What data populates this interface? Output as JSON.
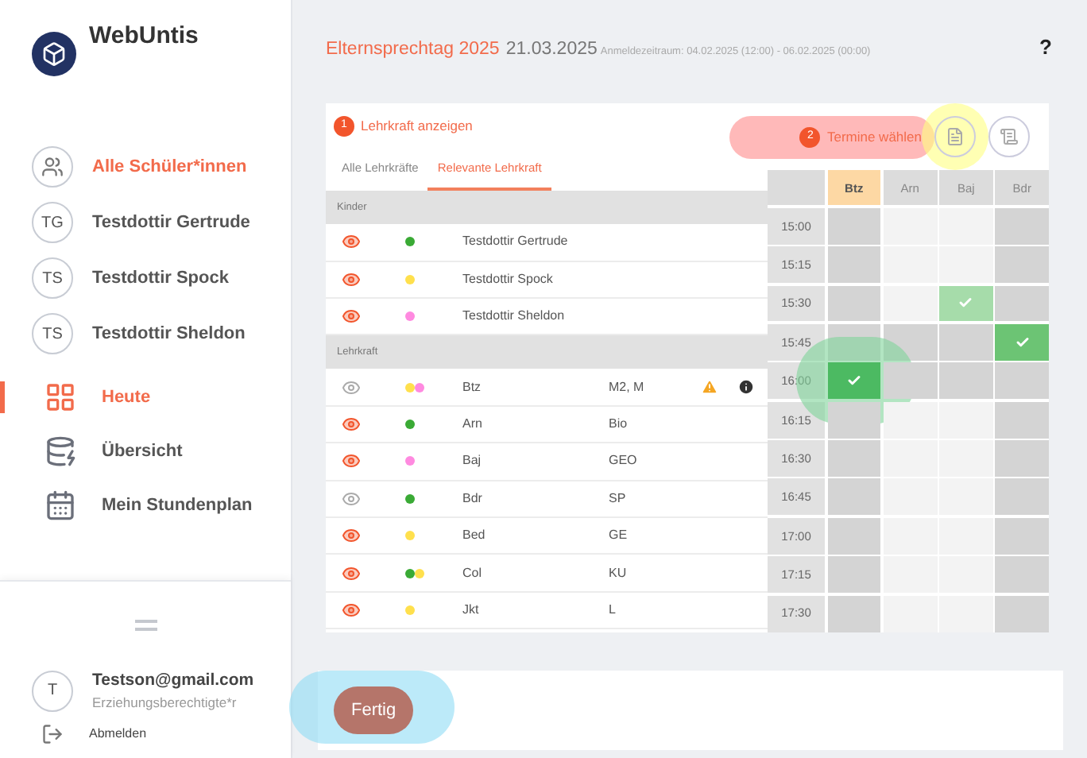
{
  "sidebar": {
    "app_name": "WebUntis",
    "students": [
      {
        "label": "Alle Schüler*innen",
        "kind": "all",
        "selected": true
      },
      {
        "initials": "TG",
        "label": "Testdottir Gertrude",
        "kind": "child",
        "selected": false
      },
      {
        "initials": "TS",
        "label": "Testdottir Spock",
        "kind": "child",
        "selected": false
      },
      {
        "initials": "TS",
        "label": "Testdottir Sheldon",
        "kind": "child",
        "selected": false
      }
    ],
    "nav": [
      {
        "label": "Heute",
        "kind": "today",
        "selected": true
      },
      {
        "label": "Übersicht",
        "kind": "overview",
        "selected": false
      },
      {
        "label": "Mein Stundenplan",
        "kind": "timetable",
        "selected": false
      }
    ],
    "user": {
      "initial": "T",
      "email": "Testson@gmail.com",
      "role": "Erziehungsberechtigte*r",
      "logout": "Abmelden"
    }
  },
  "header": {
    "title": "Elternsprechtag 2025",
    "date": "21.03.2025",
    "period": "Anmeldezeitraum: 04.02.2025 (12:00) - 06.02.2025 (00:00)",
    "help": "?"
  },
  "step1": {
    "number": "1",
    "label": "Lehrkraft anzeigen"
  },
  "step2": {
    "number": "2",
    "label": "Termine wählen",
    "highlighted": true
  },
  "pdf_button": {
    "highlighted": true
  },
  "tabs": [
    {
      "label": "Alle Lehrkräfte",
      "selected": false
    },
    {
      "label": "Relevante Lehrkraft",
      "selected": true
    }
  ],
  "sections": [
    {
      "title": "Kinder",
      "rows": [
        {
          "visible": true,
          "dots": [
            {
              "color": "#3aaa35"
            }
          ],
          "name": "Testdottir Gertrude"
        },
        {
          "visible": true,
          "dots": [
            {
              "color": "#ffe04d"
            }
          ],
          "name": "Testdottir Spock"
        },
        {
          "visible": true,
          "dots": [
            {
              "color": "#ff8ae0"
            }
          ],
          "name": "Testdottir Sheldon"
        }
      ]
    },
    {
      "title": "Lehrkraft",
      "rows": [
        {
          "visible": false,
          "dots": [
            {
              "color": "#ffe04d"
            },
            {
              "color": "#ff8ae0"
            }
          ],
          "name": "Btz",
          "subject": "M2, M",
          "warning": true,
          "info": true
        },
        {
          "visible": true,
          "dots": [
            {
              "color": "#3aaa35"
            }
          ],
          "name": "Arn",
          "subject": "Bio"
        },
        {
          "visible": true,
          "dots": [
            {
              "color": "#ff8ae0"
            }
          ],
          "name": "Baj",
          "subject": "GEO"
        },
        {
          "visible": false,
          "dots": [
            {
              "color": "#3aaa35"
            }
          ],
          "name": "Bdr",
          "subject": "SP"
        },
        {
          "visible": true,
          "dots": [
            {
              "color": "#ffe04d"
            }
          ],
          "name": "Bed",
          "subject": "GE"
        },
        {
          "visible": true,
          "dots": [
            {
              "color": "#3aaa35"
            },
            {
              "color": "#ffe04d"
            }
          ],
          "name": "Col",
          "subject": "KU"
        },
        {
          "visible": true,
          "dots": [
            {
              "color": "#ffe04d"
            }
          ],
          "name": "Jkt",
          "subject": "L"
        }
      ]
    }
  ],
  "grid": {
    "columns": [
      {
        "label": "Btz",
        "selected": true
      },
      {
        "label": "Arn",
        "selected": false
      },
      {
        "label": "Baj",
        "selected": false
      },
      {
        "label": "Bdr",
        "selected": false
      }
    ],
    "rows": [
      {
        "time": "15:00",
        "cells": [
          {
            "kind": "blocked"
          },
          {
            "kind": "free"
          },
          {
            "kind": "free"
          },
          {
            "kind": "blocked"
          }
        ]
      },
      {
        "time": "15:15",
        "cells": [
          {
            "kind": "blocked"
          },
          {
            "kind": "free"
          },
          {
            "kind": "free"
          },
          {
            "kind": "blocked"
          }
        ]
      },
      {
        "time": "15:30",
        "cells": [
          {
            "kind": "blocked"
          },
          {
            "kind": "free"
          },
          {
            "kind": "booked",
            "color": "#a6dcaa"
          },
          {
            "kind": "blocked"
          }
        ]
      },
      {
        "time": "15:45",
        "cells": [
          {
            "kind": "blocked"
          },
          {
            "kind": "blocked"
          },
          {
            "kind": "blocked"
          },
          {
            "kind": "booked",
            "color": "#6cc474"
          }
        ]
      },
      {
        "time": "16:00",
        "cells": [
          {
            "kind": "booked",
            "color": "#4cba62",
            "highlighted": true
          },
          {
            "kind": "blocked"
          },
          {
            "kind": "blocked"
          },
          {
            "kind": "blocked"
          }
        ]
      },
      {
        "time": "16:15",
        "cells": [
          {
            "kind": "blocked"
          },
          {
            "kind": "free"
          },
          {
            "kind": "free"
          },
          {
            "kind": "blocked"
          }
        ]
      },
      {
        "time": "16:30",
        "cells": [
          {
            "kind": "blocked"
          },
          {
            "kind": "free"
          },
          {
            "kind": "free"
          },
          {
            "kind": "blocked"
          }
        ]
      },
      {
        "time": "16:45",
        "cells": [
          {
            "kind": "blocked"
          },
          {
            "kind": "free"
          },
          {
            "kind": "free"
          },
          {
            "kind": "blocked"
          }
        ]
      },
      {
        "time": "17:00",
        "cells": [
          {
            "kind": "blocked"
          },
          {
            "kind": "free"
          },
          {
            "kind": "free"
          },
          {
            "kind": "blocked"
          }
        ]
      },
      {
        "time": "17:15",
        "cells": [
          {
            "kind": "blocked"
          },
          {
            "kind": "free"
          },
          {
            "kind": "free"
          },
          {
            "kind": "blocked"
          }
        ]
      },
      {
        "time": "17:30",
        "cells": [
          {
            "kind": "blocked"
          },
          {
            "kind": "free"
          },
          {
            "kind": "free"
          },
          {
            "kind": "blocked"
          }
        ]
      }
    ]
  },
  "footer": {
    "button": "Fertig",
    "highlighted": true
  }
}
